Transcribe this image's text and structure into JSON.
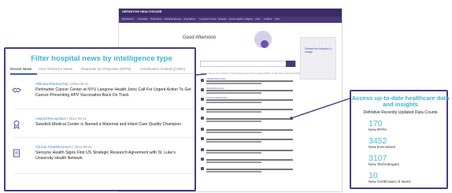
{
  "app": {
    "brand": "DEFINITIVE HEALTHCARE",
    "nav": [
      "Dashboard",
      "Hospitals",
      "Physicians",
      "Medical Groups",
      "Ambulatory",
      "Long-Term Care",
      "Hospice",
      "Home Health",
      "Imaging",
      "Labs",
      "Insights",
      "Intel"
    ],
    "greeting": "Good Afternoon",
    "tabs": "Recent News   Your Territory's News   Requests for Proposals (RFPs)   Certificates of Need (CONs)",
    "card_title": "Streamline Adoption & Usage"
  },
  "left_callout": {
    "title": "Filter hospital news by intelligence type",
    "tabs": [
      "Recent News",
      "Your Territory's News",
      "Requests for Proposals (RFPs)",
      "Certificates of Need (CONs)"
    ],
    "items": [
      {
        "category": "Affiliation/Partnership",
        "date": "2021-05-21",
        "headline": "Perlmutter Cancer Center at NYU Langone Health Joins Call For Urgent Action To Get Cancer-Preventing HPV Vaccination Back On Track"
      },
      {
        "category": "Awards/Recognition",
        "date": "2021-05-21",
        "headline": "Swedish Medical Center is Named a Maternal and Infant Care Quality Champion"
      },
      {
        "category": "Clinical Trials/Research",
        "date": "2021-05-21",
        "headline": "Sensyne Health Signs First US Strategic Research Agreement with St. Luke's University Health Network"
      }
    ]
  },
  "right_callout": {
    "title": "Access up-to-date healthcare data and insights",
    "subtitle": "Definitive Recently Updated Data Counts",
    "stats": [
      {
        "value": "170",
        "label": "New RFPs"
      },
      {
        "value": "3452",
        "label": "New Executives"
      },
      {
        "value": "3107",
        "label": "New Technologies"
      },
      {
        "value": "10",
        "label": "New Certificates of Need"
      }
    ]
  },
  "colors": {
    "accent_teal": "#3cb4cc",
    "frame_purple": "#4a3b86",
    "link_blue": "#3b8ec8",
    "nav_purple": "#3b2a63"
  }
}
